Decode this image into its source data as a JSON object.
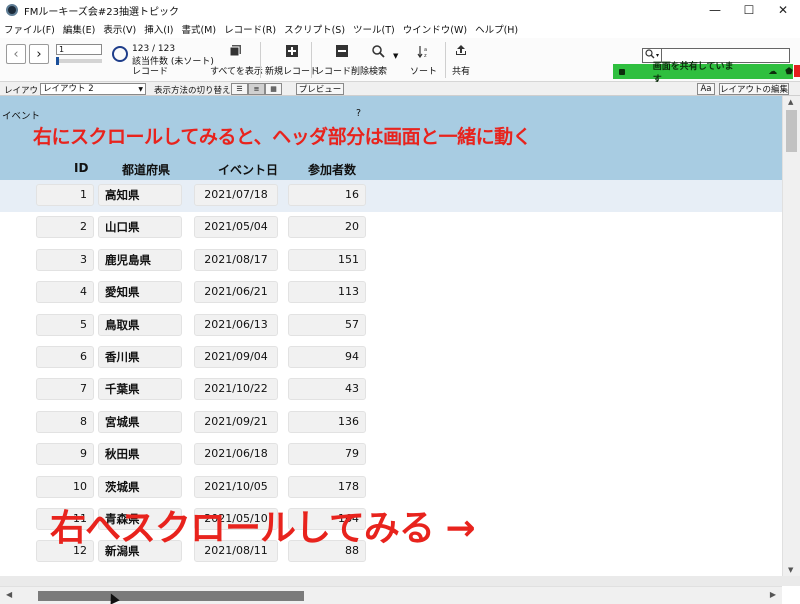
{
  "window": {
    "title": "FMルーキーズ会#23抽選トピック",
    "controls": [
      "—",
      "☐",
      "✕"
    ]
  },
  "menu": [
    "ファイル(F)",
    "編集(E)",
    "表示(V)",
    "挿入(I)",
    "書式(M)",
    "レコード(R)",
    "スクリプト(S)",
    "ツール(T)",
    "ウインドウ(W)",
    "ヘルプ(H)"
  ],
  "toolbar": {
    "record_number": "1",
    "count_line1": "123 / 123",
    "count_line2": "該当件数 (未ソート)",
    "records_label": "レコード",
    "show_all": "すべてを表示",
    "new_record": "新規レコード",
    "delete_record": "レコード削除",
    "search": "検索",
    "sort": "ソート",
    "share": "共有",
    "sharing_status": "画面を共有しています"
  },
  "layoutbar": {
    "layout_label": "レイアウト:",
    "layout_value": "レイアウト 2",
    "view_label": "表示方法の切り替え:",
    "preview": "プレビュー",
    "edit_layout": "レイアウトの編集",
    "aa": "Aa"
  },
  "header": {
    "event_label": "イベント",
    "help_mark": "?",
    "annotation_top": "右にスクロールしてみると、ヘッダ部分は画面と一緒に動く",
    "columns": {
      "id": "ID",
      "prefecture": "都道府県",
      "event_date": "イベント日",
      "attendees": "参加者数"
    }
  },
  "rows": [
    {
      "id": "1",
      "prefecture": "高知県",
      "date": "2021/07/18",
      "count": "16"
    },
    {
      "id": "2",
      "prefecture": "山口県",
      "date": "2021/05/04",
      "count": "20"
    },
    {
      "id": "3",
      "prefecture": "鹿児島県",
      "date": "2021/08/17",
      "count": "151"
    },
    {
      "id": "4",
      "prefecture": "愛知県",
      "date": "2021/06/21",
      "count": "113"
    },
    {
      "id": "5",
      "prefecture": "鳥取県",
      "date": "2021/06/13",
      "count": "57"
    },
    {
      "id": "6",
      "prefecture": "香川県",
      "date": "2021/09/04",
      "count": "94"
    },
    {
      "id": "7",
      "prefecture": "千葉県",
      "date": "2021/10/22",
      "count": "43"
    },
    {
      "id": "8",
      "prefecture": "宮城県",
      "date": "2021/09/21",
      "count": "136"
    },
    {
      "id": "9",
      "prefecture": "秋田県",
      "date": "2021/06/18",
      "count": "79"
    },
    {
      "id": "10",
      "prefecture": "茨城県",
      "date": "2021/10/05",
      "count": "178"
    },
    {
      "id": "11",
      "prefecture": "青森県",
      "date": "2021/05/10",
      "count": "164"
    },
    {
      "id": "12",
      "prefecture": "新潟県",
      "date": "2021/08/11",
      "count": "88"
    }
  ],
  "annotation_bottom": "右へスクロールしてみる →",
  "colors": {
    "header_band": "#a8cce2",
    "annotation_red": "#e8231d",
    "share_green": "#2fbf3f",
    "selected_row": "#e7eef6"
  }
}
